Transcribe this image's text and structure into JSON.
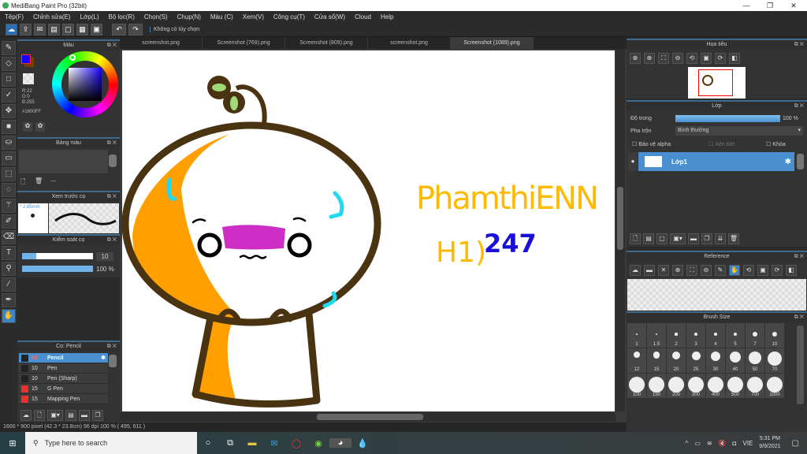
{
  "app": {
    "title": "MediBang Paint Pro (32bit)"
  },
  "menu": [
    "Tệp(F)",
    "Chỉnh sửa(E)",
    "Lớp(L)",
    "Bộ lọc(R)",
    "Chọn(S)",
    "Chụp(N)",
    "Màu (C)",
    "Xem(V)",
    "Công cụ(T)",
    "Cửa sổ(W)",
    "Cloud",
    "Help"
  ],
  "toolbar": {
    "options_text": "Không có tùy chọn"
  },
  "tabs": [
    "screenshot.png",
    "Screenshot (769).png",
    "Screenshot (809).png",
    "screenshot.png",
    "Screenshot (1089).png"
  ],
  "color_panel": {
    "title": "Màu",
    "r": "R:22",
    "g": "G:0",
    "b": "B:255",
    "hex": "#1600FF",
    "fg_color": "#1600FF"
  },
  "palette_panel": {
    "title": "Bảng màu",
    "placeholder": "---"
  },
  "brush_preview": {
    "title": "Xem trước cọ",
    "size": "* 2.65mm"
  },
  "brush_control": {
    "title": "Kiểm soát cọ",
    "size_value": "10",
    "opacity_value": "100 %",
    "size_fraction": 0.2,
    "opacity_fraction": 1.0
  },
  "brush_list": {
    "title": "Cọ: Pencil",
    "items": [
      {
        "size": "10",
        "name": "Pencil",
        "color": "#222222",
        "selected": true
      },
      {
        "size": "10",
        "name": "Pen",
        "color": "#222222"
      },
      {
        "size": "10",
        "name": "Pen (Sharp)",
        "color": "#222222"
      },
      {
        "size": "15",
        "name": "G Pen",
        "color": "#e83030"
      },
      {
        "size": "15",
        "name": "Mapping Pen",
        "color": "#e83030"
      }
    ]
  },
  "status": {
    "text": "1600 * 900 pixel   (42.3 * 23.8cm)   96 dpi   100 %   ( 495, 611 )"
  },
  "navigator": {
    "title": "Họa tiêu"
  },
  "layer_panel": {
    "title": "Lớp",
    "opacity_label": "Độ trong",
    "opacity_value": "100 %",
    "blend_label": "Pha trộn",
    "blend_value": "Bình thường",
    "protect_alpha": "Bảo vệ alpha",
    "clipping": "Xén bớt",
    "lock": "Khóa",
    "layers": [
      {
        "name": "Lớp1"
      }
    ]
  },
  "reference": {
    "title": "Reference"
  },
  "brush_size": {
    "title": "Brush Size",
    "sizes": [
      "1",
      "1.5",
      "2",
      "3",
      "4",
      "5",
      "7",
      "10",
      "12",
      "15",
      "20",
      "25",
      "30",
      "40",
      "50",
      "70",
      "100",
      "150",
      "200",
      "300",
      "400",
      "500",
      "700",
      "1000"
    ]
  },
  "drawing": {
    "line1": "PhamthiENN",
    "line2a": "H1)",
    "line2b": "247"
  },
  "taskbar": {
    "search_placeholder": "Type here to search",
    "lang": "VIE",
    "time": "5:31 PM",
    "date": "9/9/2021"
  }
}
